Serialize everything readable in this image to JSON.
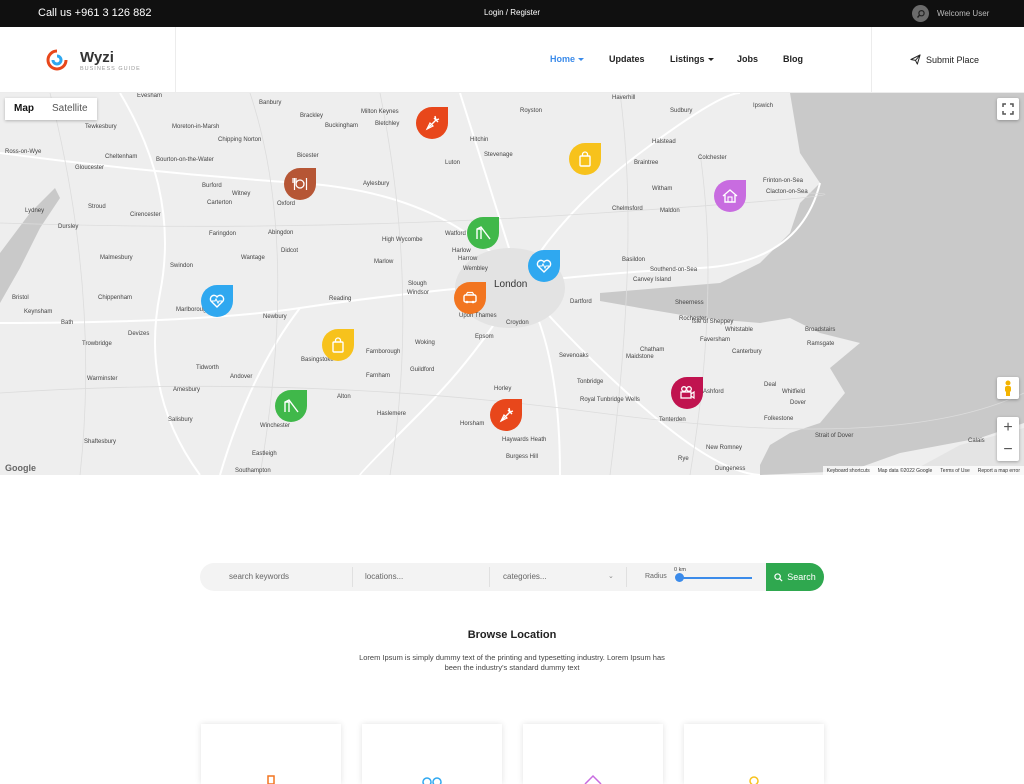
{
  "topbar": {
    "phone": "Call us +961 3 126 882",
    "login": "Login / Register",
    "welcome": "Welcome User"
  },
  "header": {
    "logo_name": "Wyzi",
    "logo_tagline": "BUSINESS GUIDE",
    "nav": [
      {
        "label": "Home",
        "active": true,
        "dropdown": true
      },
      {
        "label": "Updates",
        "active": false,
        "dropdown": false
      },
      {
        "label": "Listings",
        "active": false,
        "dropdown": true
      },
      {
        "label": "Jobs",
        "active": false,
        "dropdown": false
      },
      {
        "label": "Blog",
        "active": false,
        "dropdown": false
      }
    ],
    "submit_label": "Submit Place"
  },
  "map": {
    "type_map": "Map",
    "type_satellite": "Satellite",
    "main_city": "London",
    "places": [
      "Evesham",
      "Banbury",
      "Brackley",
      "Buckingham",
      "Milton Keynes",
      "Bletchley",
      "Royston",
      "Haverhill",
      "Ipswich",
      "Tewkesbury",
      "Moreton-in-Marsh",
      "Chipping Norton",
      "Hitchin",
      "Stevenage",
      "Sudbury",
      "Cheltenham",
      "Bourton-on-the-Water",
      "Bicester",
      "Luton",
      "Halstead",
      "Colchester",
      "Ross-on-Wye",
      "Gloucester",
      "Burford",
      "Witney",
      "Oxford",
      "Aylesbury",
      "Braintree",
      "Witham",
      "Frinton-on-Sea",
      "Clacton-on-Sea",
      "Stroud",
      "Carterton",
      "Lydney",
      "Cirencester",
      "Harlow",
      "Chelmsford",
      "Maldon",
      "Dursley",
      "Faringdon",
      "Abingdon",
      "Watford",
      "Malmesbury",
      "Wantage",
      "Didcot",
      "High Wycombe",
      "Harrow",
      "Basildon",
      "Swindon",
      "Marlow",
      "Wembley",
      "Southend-on-Sea",
      "Canvey Island",
      "Slough",
      "Windsor",
      "Dartford",
      "Bristol",
      "Chippenham",
      "Reading",
      "Sheerness",
      "Keynsham",
      "Marlborough",
      "Newbury",
      "Isle of Sheppey",
      "Bath",
      "Devizes",
      "Upon Thames",
      "Rochester",
      "Chatham",
      "Whitstable",
      "Broadstairs",
      "Trowbridge",
      "Croydon",
      "Epsom",
      "Ramsgate",
      "Sevenoaks",
      "Faversham",
      "Canterbury",
      "Basingstoke",
      "Farnborough",
      "Woking",
      "Maidstone",
      "Tidworth",
      "Andover",
      "Guildford",
      "Farnham",
      "Tonbridge",
      "Warminster",
      "Ashford",
      "Deal",
      "Amesbury",
      "Royal Tunbridge Wells",
      "Dover",
      "Salisbury",
      "Alton",
      "Horley",
      "Whitfield",
      "Winchester",
      "Haslemere",
      "Horsham",
      "Tenterden",
      "Folkestone",
      "Shaftesbury",
      "Haywards Heath",
      "Burgess Hill",
      "Rye",
      "New Romney",
      "Eastleigh",
      "Southampton",
      "Dungeness",
      "Calais",
      "Strait of Dover"
    ],
    "attribution": [
      "Keyboard shortcuts",
      "Map data ©2022 Google",
      "Terms of Use",
      "Report a map error"
    ],
    "google": "Google",
    "pins": [
      {
        "icon": "carrot-icon",
        "color": "#e8471b"
      },
      {
        "icon": "shopping-bag-icon",
        "color": "#f7c21c"
      },
      {
        "icon": "restaurant-icon",
        "color": "#b65635"
      },
      {
        "icon": "real-estate-icon",
        "color": "#c86ce0"
      },
      {
        "icon": "playground-icon",
        "color": "#40b84a"
      },
      {
        "icon": "health-icon",
        "color": "#2fa8f0"
      },
      {
        "icon": "health-icon",
        "color": "#2fa8f0"
      },
      {
        "icon": "car-icon",
        "color": "#f27520"
      },
      {
        "icon": "shopping-bag-icon",
        "color": "#f7c21c"
      },
      {
        "icon": "cinema-icon",
        "color": "#c0134f"
      },
      {
        "icon": "playground-icon",
        "color": "#40b84a"
      },
      {
        "icon": "carrot-icon",
        "color": "#e8471b"
      }
    ]
  },
  "search": {
    "keywords_placeholder": "search keywords",
    "locations_placeholder": "locations...",
    "categories_placeholder": "categories...",
    "radius_label": "Radius",
    "radius_value": "0 km",
    "button_label": "Search"
  },
  "browse": {
    "title": "Browse Location",
    "description": "Lorem Ipsum is simply dummy text of the printing and typesetting industry. Lorem Ipsum has been the industry's standard dummy text"
  },
  "colors": {
    "accent": "#3b8bea",
    "search_button": "#2fa84f",
    "topbar": "#101010"
  }
}
